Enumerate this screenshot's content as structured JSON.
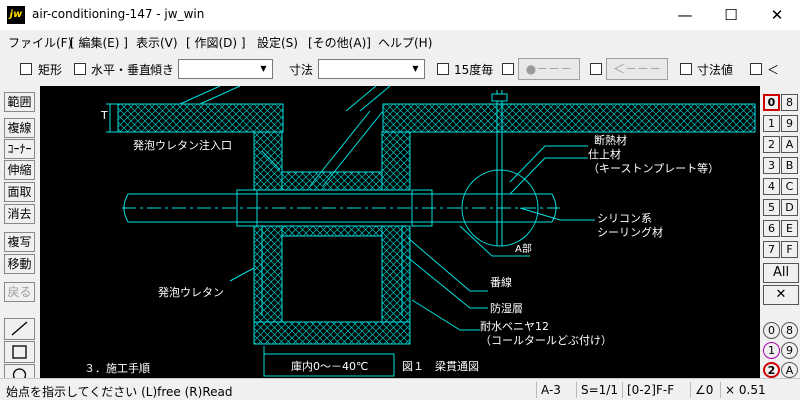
{
  "window": {
    "title": "air-conditioning-147 - jw_win",
    "app_icon": "jw",
    "minimize": "—",
    "maximize": "☐",
    "close": "✕"
  },
  "menu": [
    "ファイル(F)",
    "[ 編集(E) ]",
    "表示(V)",
    "[ 作図(D) ]",
    "設定(S)",
    "[その他(A)]",
    "ヘルプ(H)"
  ],
  "toolbar": {
    "rect_label": "矩形",
    "horiz_vert_label": "水平・垂直",
    "tilt_label": "傾き",
    "tilt_value": "",
    "dim_label": "寸法",
    "dim_value": "",
    "deg15_label": "15度毎",
    "btn1_label": "●－－－",
    "btn2_label": "＜－－－",
    "dimval_label": "寸法値",
    "lt_label": "＜"
  },
  "left_tools": {
    "range": "範囲",
    "multiline": "複線",
    "corner": "ｺｰﾅｰ",
    "stretch": "伸縮",
    "chamfer": "面取",
    "erase": "消去",
    "copy": "複写",
    "move": "移動",
    "back": "戻る"
  },
  "right_layers": {
    "left": [
      "0",
      "1",
      "2",
      "3",
      "4",
      "5",
      "6",
      "7"
    ],
    "right": [
      "8",
      "9",
      "A",
      "B",
      "C",
      "D",
      "E",
      "F"
    ],
    "all": "All",
    "close": "✕",
    "bottom": [
      "0",
      "8",
      "1",
      "9",
      "2",
      "A"
    ]
  },
  "drawing": {
    "dim_t": "T",
    "label_foam_inlet": "発泡ウレタン注入口",
    "label_insulation": "断熱材",
    "label_finish": "仕上材",
    "label_finish_note": "（キーストンプレート等）",
    "label_silicone": "シリコン系",
    "label_sealing": "シーリング材",
    "label_detail_a": "A部",
    "label_foam": "発泡ウレタン",
    "label_wire": "番線",
    "label_moisture": "防湿層",
    "label_plywood": "耐水ベニヤ12",
    "label_coaltar": "（コールタールどぶ付け）",
    "label_procedure": "３．施工手順",
    "caption_box": "庫内0～－40℃",
    "caption_fig": "図１　梁貫通図"
  },
  "status": {
    "message": "始点を指示してください (L)free (R)Read",
    "paper": "A-3",
    "scale": "S=1/1",
    "layer": "[0-2]F-F",
    "angle": "∠0",
    "factor": "× 0.51"
  },
  "colors": {
    "canvas_bg": "#000000",
    "drawing_line": "#00e0e0",
    "active_layer_border": "#d00000"
  }
}
